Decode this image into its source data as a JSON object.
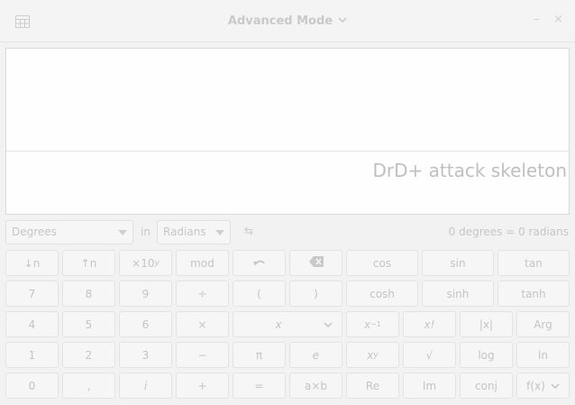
{
  "header": {
    "title": "Advanced Mode",
    "menu_icon": "grid-menu-icon",
    "minimize": "–",
    "close": "×"
  },
  "display": {
    "history": "",
    "entry": "DrD+ attack skeleton"
  },
  "conversion": {
    "from_unit": "Degrees",
    "in_label": "in",
    "to_unit": "Radians",
    "swap_symbol": "⇆",
    "result": "0 degrees = 0 radians"
  },
  "keypad": {
    "row1": [
      "↓n",
      "↑n",
      "×10",
      "mod",
      "undo",
      "backspace",
      "cos",
      "sin",
      "tan"
    ],
    "x10_sup": "y",
    "row2": [
      "7",
      "8",
      "9",
      "÷",
      "(",
      ")",
      "cosh",
      "sinh",
      "tanh"
    ],
    "row3": [
      "4",
      "5",
      "6",
      "×",
      "x",
      "x",
      "−1",
      "x!",
      "|x|",
      "Arg"
    ],
    "row4": [
      "1",
      "2",
      "3",
      "−",
      "π",
      "e",
      "x",
      "y",
      "√",
      "log",
      "ln"
    ],
    "row5": [
      "0",
      ",",
      "i",
      "+",
      "=",
      "a×b",
      "Re",
      "Im",
      "conj",
      "f(x)"
    ]
  },
  "colors": {
    "background": "#f2f2f2",
    "button": "#f6f6f6",
    "text": "#c4c4c4"
  }
}
